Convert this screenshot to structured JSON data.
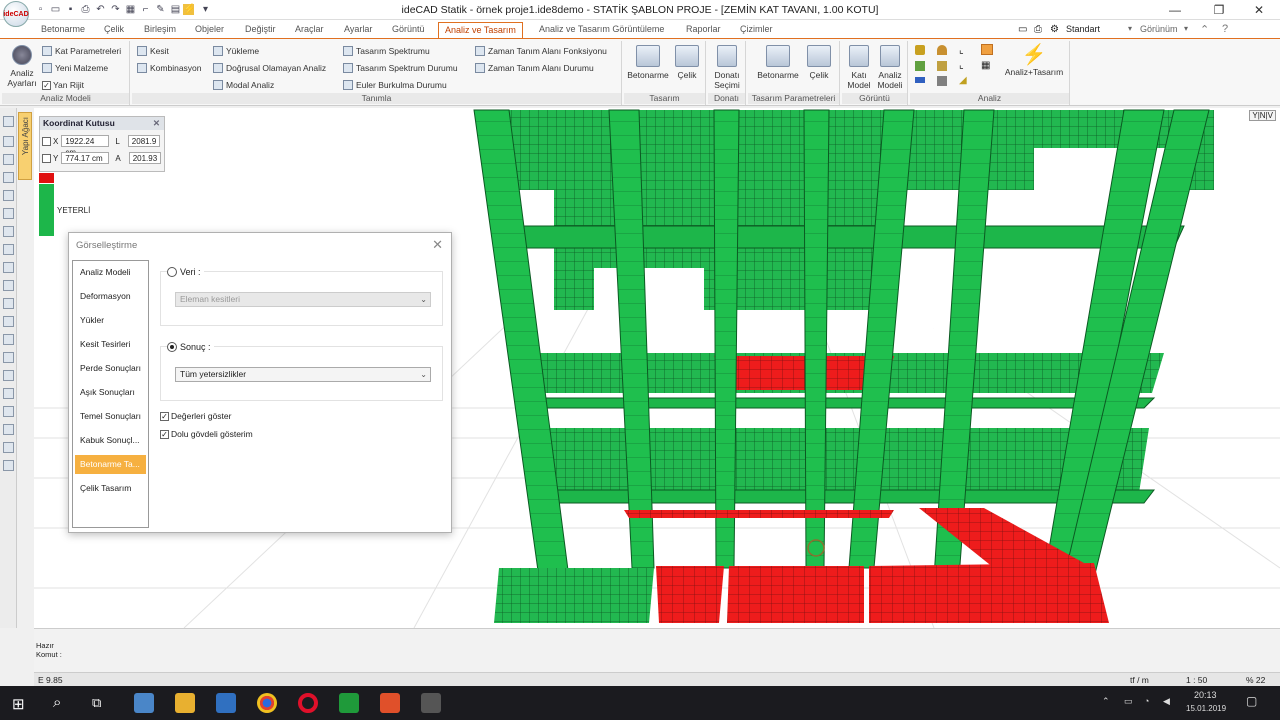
{
  "window": {
    "title": "ideCAD Statik - örnek proje1.ide8demo - STATİK ŞABLON PROJE - [ZEMİN KAT TAVANI,  1.00 KOTU]",
    "logo": "ideCAD",
    "minimize": "—",
    "maximize": "❐",
    "close": "✕"
  },
  "tabs": [
    "Betonarme",
    "Çelik",
    "Birleşim",
    "Objeler",
    "Değiştir",
    "Araçlar",
    "Ayarlar",
    "Görüntü",
    "Analiz ve Tasarım",
    "Analiz ve Tasarım Görüntüleme",
    "Raporlar",
    "Çizimler"
  ],
  "active_tab": "Analiz ve Tasarım",
  "top_right": {
    "style": "Standart",
    "view": "Görünüm"
  },
  "ribbon": {
    "analiz_modeli": {
      "big": "Analiz Ayarları",
      "items": [
        "Kat Parametreleri",
        "Yeni Malzeme",
        "Yan Rijit"
      ],
      "label": "Analiz Modeli"
    },
    "tanimla": {
      "col1": [
        "Kesit",
        "Kombinasyon"
      ],
      "col2": [
        "Yükleme",
        "Doğrusal Olamayan Analiz",
        "Modal Analiz"
      ],
      "col3": [
        "Tasarım Spektrumu",
        "Tasarım Spektrum Durumu",
        "Euler Burkulma Durumu"
      ],
      "col4": [
        "Zaman Tanım Alanı Fonksiyonu",
        "Zaman Tanım Alanı Durumu"
      ],
      "label": "Tanımla"
    },
    "tasarim": {
      "items": [
        "Betonarme",
        "Çelik"
      ],
      "label": "Tasarım"
    },
    "donati": {
      "items": [
        "Donatı Seçimi"
      ],
      "label": "Donatı"
    },
    "tasarim_param": {
      "items": [
        "Betonarme",
        "Çelik"
      ],
      "label": "Tasarım Parametreleri"
    },
    "goruntu": {
      "items": [
        "Katı Model",
        "Analiz Modeli"
      ],
      "label": "Görüntü"
    },
    "analiz": {
      "items": [
        "Analiz+Tasarım"
      ],
      "label": "Analiz"
    }
  },
  "side_tab": "Yapı Ağacı",
  "koordinat": {
    "title": "Koordinat Kutusu",
    "x_label": "X",
    "x_value": "1922.24 cm",
    "y_label": "Y",
    "y_value": "774.17 cm",
    "l_label": "L",
    "l_value": "2081.9",
    "a_label": "A",
    "a_value": "201.93"
  },
  "legend": {
    "label": "YETERLİ",
    "fail_color": "#e01010",
    "ok_color": "#1db64a"
  },
  "viewcube": "Y|N|V",
  "dialog": {
    "title": "Görselleştirme",
    "close": "✕",
    "nav": [
      "Analiz Modeli",
      "Deformasyon",
      "Yükler",
      "Kesit Tesirleri",
      "Perde Sonuçları",
      "Aşık Sonuçları",
      "Temel Sonuçları",
      "Kabuk Sonuçl...",
      "Betonarme Ta...",
      "Çelik Tasarım"
    ],
    "nav_selected": 8,
    "veri_label": "Veri :",
    "veri_value": "Eleman kesitleri",
    "sonuc_label": "Sonuç :",
    "sonuc_value": "Tüm yetersizlikler",
    "check1": "Değerleri göster",
    "check2": "Dolu gövdeli gösterim"
  },
  "command": {
    "line1": "Hazır",
    "line2": "Komut :"
  },
  "status": {
    "left": "E 9.85",
    "unit": "tf / m",
    "scale": "1 : 50",
    "zoom": "% 22"
  },
  "taskbar": {
    "time": "20:13",
    "date": "15.01.2019"
  }
}
